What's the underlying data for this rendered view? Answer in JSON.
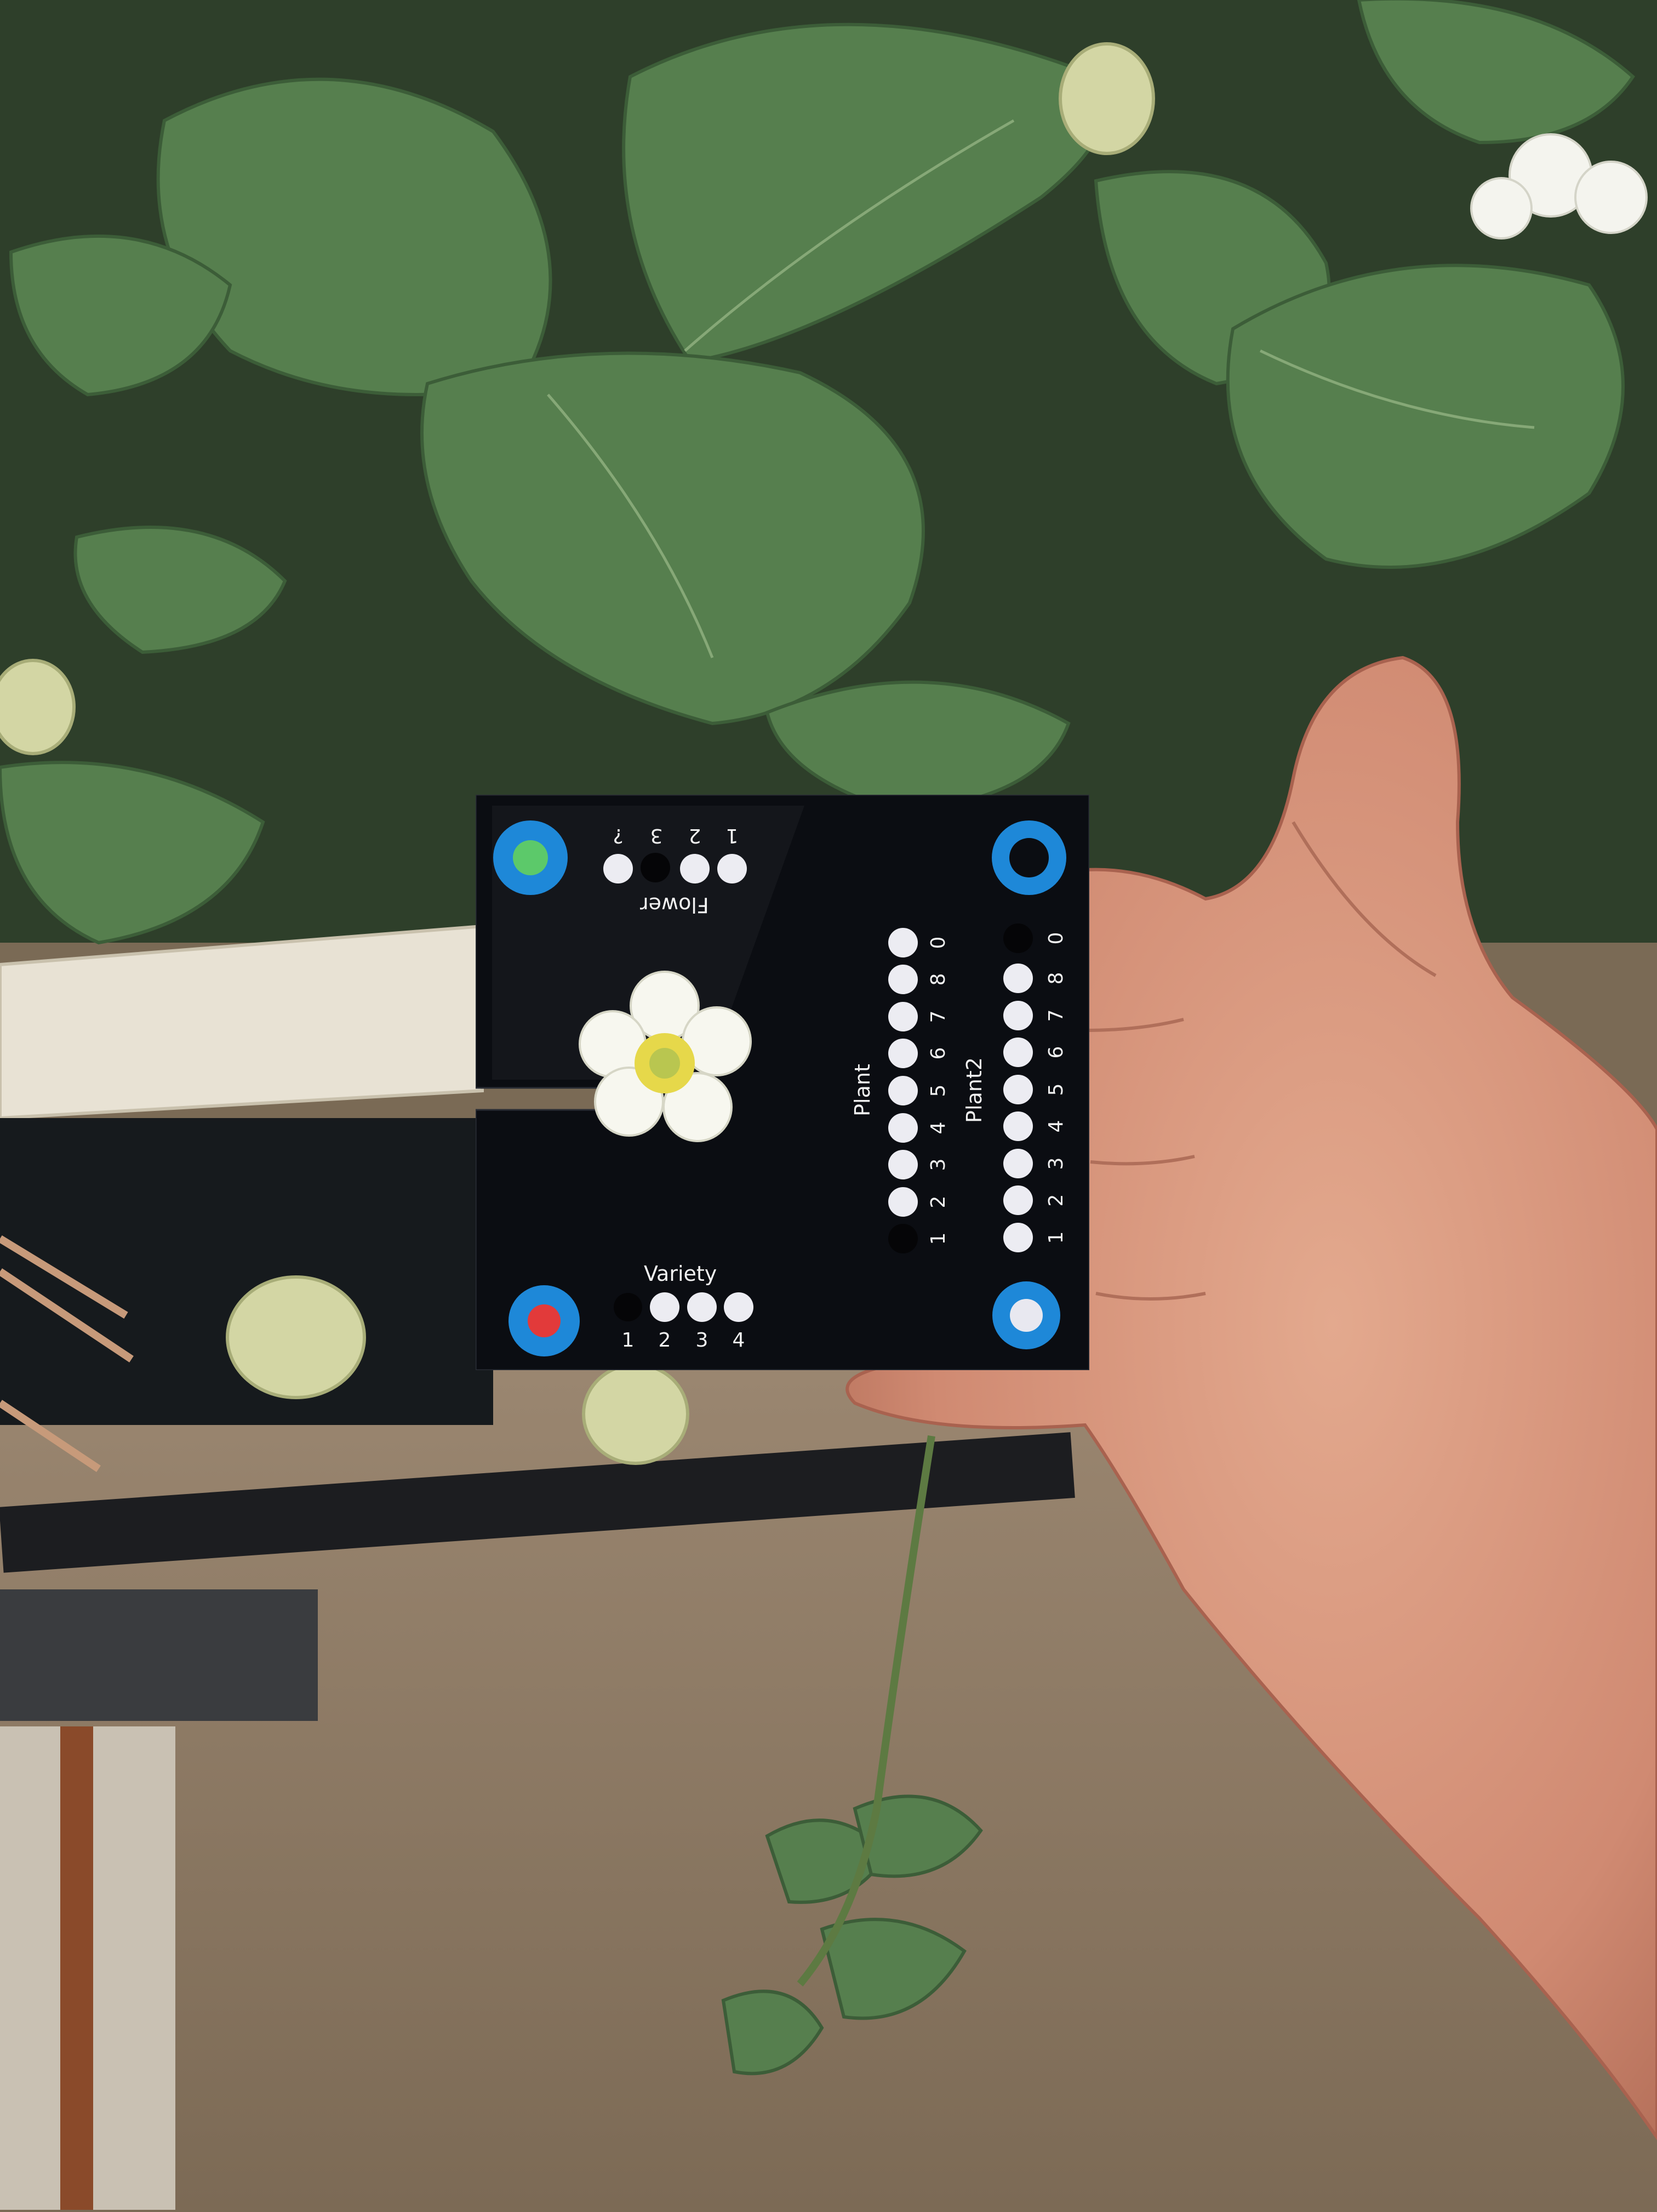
{
  "card": {
    "flower_label": "Flower",
    "flower_digits": [
      "1",
      "2",
      "3",
      "?"
    ],
    "variety_label": "Variety",
    "variety_digits": [
      "1",
      "2",
      "3",
      "4"
    ],
    "plant_label": "Plant",
    "plant2_label": "Plant2",
    "plant_digits": [
      "1",
      "2",
      "3",
      "4",
      "5",
      "6",
      "7",
      "8",
      "0"
    ],
    "marker_colors": {
      "ring": "#1e88d8",
      "top_left_center": "#5cc96a",
      "top_right_center": "#111111",
      "bottom_left_center": "#e23a3a",
      "bottom_right_center": "#e8e8f0"
    }
  },
  "colors": {
    "card_bg": "#0b0d12",
    "leaf": "#4f7a4a",
    "ground": "#8a7660",
    "skin": "#d99a80"
  }
}
